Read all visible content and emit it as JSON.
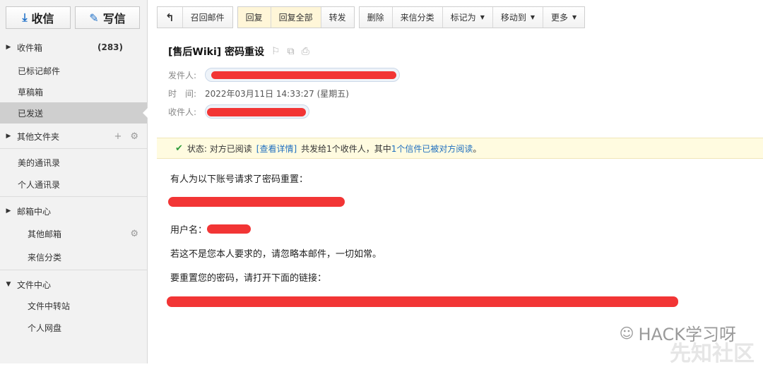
{
  "sidebar": {
    "receive_label": "收信",
    "compose_label": "写信",
    "items": [
      {
        "label": "收件箱",
        "count": "(283)"
      },
      {
        "label": "已标记邮件"
      },
      {
        "label": "草稿箱"
      },
      {
        "label": "已发送"
      },
      {
        "label": "其他文件夹"
      },
      {
        "label": "美的通讯录"
      },
      {
        "label": "个人通讯录"
      },
      {
        "label": "邮箱中心"
      },
      {
        "label": "其他邮箱"
      },
      {
        "label": "来信分类"
      },
      {
        "label": "文件中心"
      },
      {
        "label": "文件中转站"
      },
      {
        "label": "个人网盘"
      }
    ],
    "add_symbol": "+",
    "gear_symbol": "⚙"
  },
  "toolbar": {
    "back": "↰",
    "recall": "召回邮件",
    "reply": "回复",
    "reply_all": "回复全部",
    "forward": "转发",
    "delete": "删除",
    "classify": "来信分类",
    "mark_as": "标记为",
    "move_to": "移动到",
    "more": "更多"
  },
  "mail": {
    "subject": "[售后Wiki] 密码重设",
    "from_label": "发件人:",
    "time_label": "时　间:",
    "time_value": "2022年03月11日 14:33:27 (星期五)",
    "to_label": "收件人:"
  },
  "status_bar": {
    "status_text": "状态: 对方已阅读",
    "details_link": "[查看详情]",
    "summary_prefix": "共发给1个收件人，其中",
    "summary_link": "1个信件已被对方阅读",
    "summary_suffix": "。"
  },
  "body": {
    "line1": "有人为以下账号请求了密码重置：",
    "username_label": "用户名：",
    "line3": "若这不是您本人要求的，请忽略本邮件，一切如常。",
    "line4": "要重置您的密码，请打开下面的链接："
  },
  "watermark": {
    "text": "HACK学习呀",
    "text2": "先知社区"
  },
  "colors": {
    "redaction": "#f23535",
    "link": "#1f6fbf",
    "accent": "#1f70c8"
  }
}
